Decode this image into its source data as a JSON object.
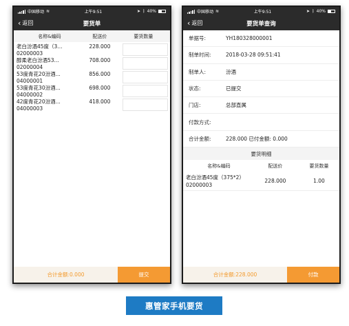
{
  "status_bar": {
    "carrier": "中国移动",
    "time": "上午9:51",
    "battery": "40%"
  },
  "left": {
    "back_label": "返回",
    "title": "要货单",
    "columns": [
      "名称&编码",
      "配送价",
      "要货数量"
    ],
    "rows": [
      {
        "name": "老白汾酒45度（3...",
        "code": "02000003",
        "price": "228.000",
        "qty": ""
      },
      {
        "name": "醇柔老白汾酒53...",
        "code": "02000004",
        "price": "708.000",
        "qty": ""
      },
      {
        "name": "53度青花20汾酒...",
        "code": "04000001",
        "price": "856.000",
        "qty": ""
      },
      {
        "name": "53度青花30汾酒...",
        "code": "04000002",
        "price": "698.000",
        "qty": ""
      },
      {
        "name": "42度青花20汾酒...",
        "code": "04000003",
        "price": "418.000",
        "qty": ""
      }
    ],
    "total_label": "合计金额:0.000",
    "submit_label": "提交"
  },
  "right": {
    "back_label": "返回",
    "title": "要货单查询",
    "fields": [
      {
        "label": "单据号:",
        "value": "YH180328000001"
      },
      {
        "label": "制单时间:",
        "value": "2018-03-28 09:51:41"
      },
      {
        "label": "制单人:",
        "value": "汾酒"
      },
      {
        "label": "状态:",
        "value": "已提交"
      },
      {
        "label": "门店:",
        "value": "总部直属"
      },
      {
        "label": "付款方式:",
        "value": ""
      },
      {
        "label": "合计金额:",
        "value": "228.000  已付金额: 0.000"
      }
    ],
    "detail_title": "要货明细",
    "detail_columns": [
      "名称&编码",
      "配送价",
      "要货数量"
    ],
    "detail_rows": [
      {
        "name": "老白汾酒45度（375*2）",
        "code": "02000003",
        "price": "228.000",
        "qty": "1.00"
      }
    ],
    "total_label": "合计金额:228.000",
    "pay_label": "付款"
  },
  "caption": "惠管家手机要货",
  "colors": {
    "accent": "#f49a33",
    "caption_bg": "#1e7bc4",
    "header_bg": "#2b2b2b"
  }
}
